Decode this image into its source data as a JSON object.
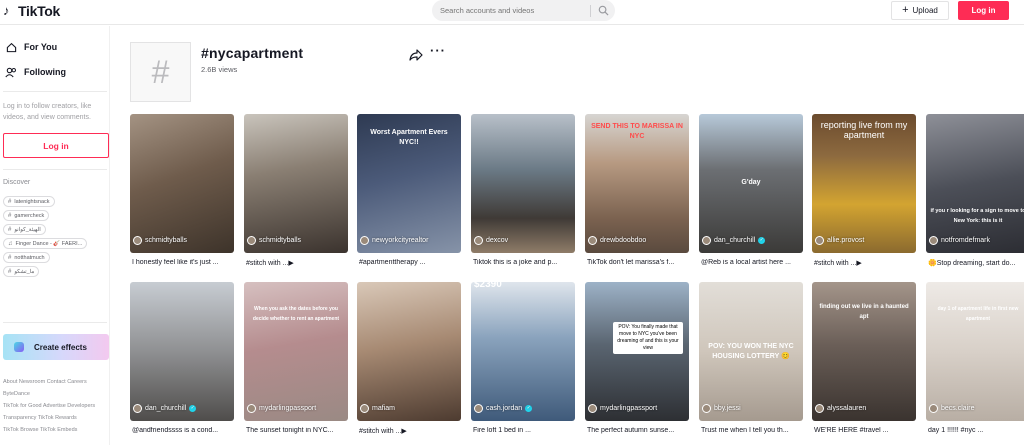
{
  "header": {
    "logo_text": "TikTok",
    "search_placeholder": "Search accounts and videos",
    "upload_label": "Upload",
    "login_label": "Log in"
  },
  "sidebar": {
    "nav": [
      {
        "label": "For You",
        "icon": "home-icon"
      },
      {
        "label": "Following",
        "icon": "users-icon"
      }
    ],
    "login_hint": "Log in to follow creators, like videos, and view comments.",
    "login_button": "Log in",
    "discover_title": "Discover",
    "chips": [
      {
        "icon": "hashtag-icon",
        "label": "latenightsnack"
      },
      {
        "icon": "hashtag-icon",
        "label": "gamercheck"
      },
      {
        "icon": "hashtag-icon",
        "label": "الهيئة_كوانو"
      },
      {
        "icon": "music-icon",
        "label": "Finger Dance - 🎸 FAERI..."
      },
      {
        "icon": "hashtag-icon",
        "label": "notthatmuch"
      },
      {
        "icon": "hashtag-icon",
        "label": "ما_تشكو"
      }
    ],
    "effects_label": "Create effects",
    "footer_lines": [
      "About  Newsroom  Contact  Careers",
      "ByteDance",
      "TikTok for Good  Advertise  Developers",
      "Transparency  TikTok Rewards",
      "TikTok Browse  TikTok Embeds"
    ]
  },
  "tag": {
    "title": "#nycapartment",
    "views": "2.6B views"
  },
  "videos": [
    {
      "user": "schmidtyballs",
      "verified": false,
      "caption": "I honestly feel like it's just ...",
      "overlay": ""
    },
    {
      "user": "schmidtyballs",
      "verified": false,
      "caption": "#stitch with ...▶",
      "overlay": ""
    },
    {
      "user": "newyorkcityrealtor",
      "verified": false,
      "caption": "#apartmenttherapy ...",
      "overlay": "Worst Apartment Evers NYC!!"
    },
    {
      "user": "dexcov",
      "verified": false,
      "caption": "Tiktok this is a joke and p...",
      "overlay": ""
    },
    {
      "user": "drewbdoobdoo",
      "verified": false,
      "caption": "TikTok don't let marissa's f...",
      "overlay": "SEND THIS TO MARISSA IN NYC"
    },
    {
      "user": "dan_churchill",
      "verified": true,
      "caption": "@Reb is a local artist here ...",
      "overlay": "G'day"
    },
    {
      "user": "allie.provost",
      "verified": false,
      "caption": "#stitch with ...▶",
      "overlay": "reporting live from my apartment"
    },
    {
      "user": "notfromdefmark",
      "verified": false,
      "caption": "🌼Stop dreaming, start do...",
      "overlay": "if you r looking for a sign to move to New York: this is it"
    },
    {
      "user": "dan_churchill",
      "verified": true,
      "caption": "@andfriendssss is a cond...",
      "overlay": ""
    },
    {
      "user": "mydarlingpassport",
      "verified": false,
      "caption": "The sunset tonight in NYC...",
      "overlay": "When you ask the dates before you decide whether to rent an apartment"
    },
    {
      "user": "mafiam",
      "verified": false,
      "caption": "#stitch with ...▶",
      "overlay": ""
    },
    {
      "user": "cash.jordan",
      "verified": true,
      "caption": "Fire loft 1 bed in ...",
      "overlay": "$2390"
    },
    {
      "user": "mydarlingpassport",
      "verified": false,
      "caption": "The perfect autumn sunse...",
      "overlay": "POV: You finally made that move to NYC you've been dreaming of and this is your view"
    },
    {
      "user": "bby.jessi",
      "verified": false,
      "caption": "Trust me when I tell you th...",
      "overlay": "POV: YOU WON THE NYC HOUSING LOTTERY 😊"
    },
    {
      "user": "alyssalauren",
      "verified": false,
      "caption": "WE'RE HERE #travel ...",
      "overlay": "finding out we live in a haunted apt"
    },
    {
      "user": "becs.claire",
      "verified": false,
      "caption": "day 1 !!!!!! #nyc ...",
      "overlay": "day 1 of apartment life in first new apartment"
    }
  ],
  "colors": {
    "accent": "#fe2c55",
    "verified": "#20d5ec"
  }
}
